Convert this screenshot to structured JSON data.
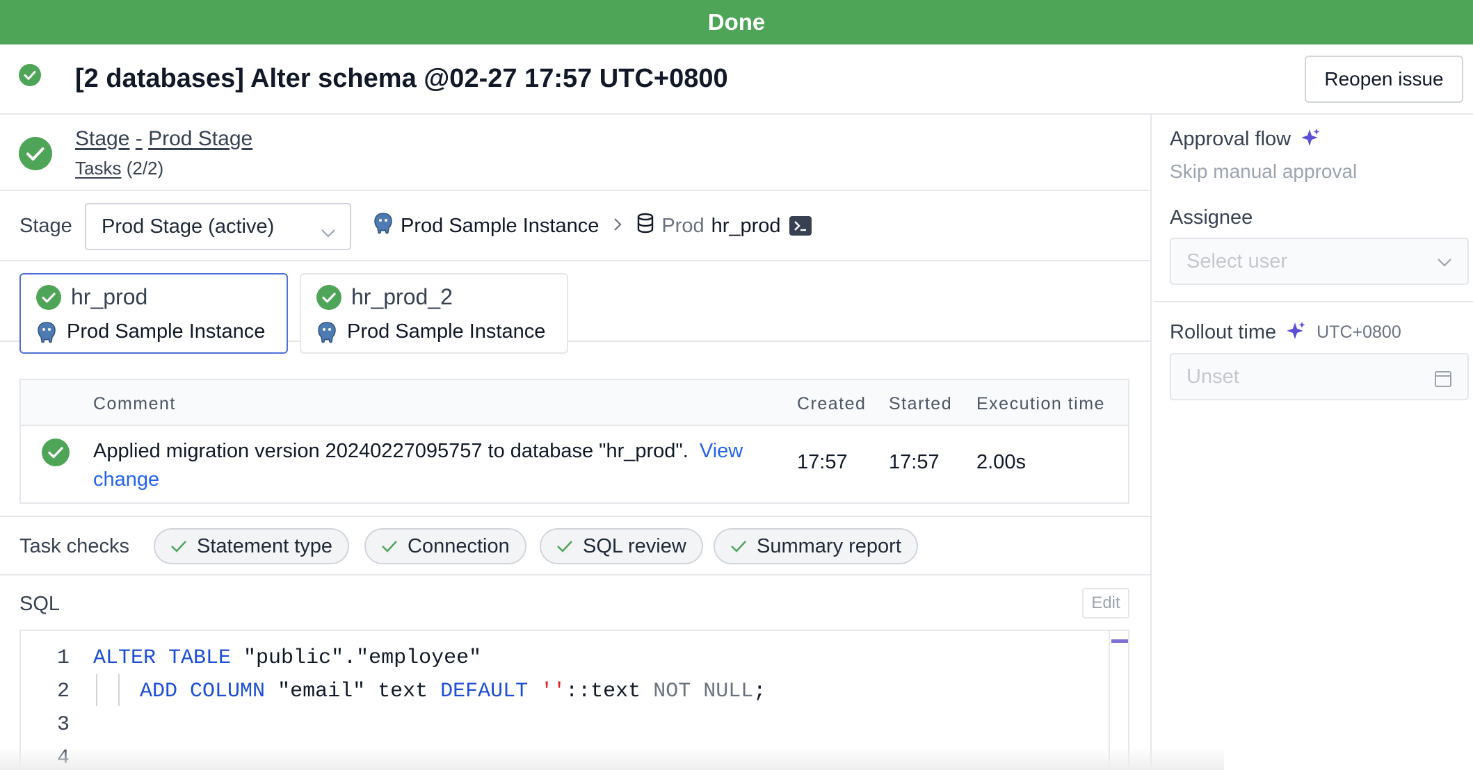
{
  "banner": {
    "status": "Done"
  },
  "header": {
    "title": "[2 databases] Alter schema @02-27 17:57 UTC+0800",
    "reopen_label": "Reopen issue"
  },
  "stage_header": {
    "stage_word": "Stage",
    "separator": "-",
    "stage_name": "Prod Stage",
    "tasks_word": "Tasks",
    "tasks_count": "(2/2)"
  },
  "stage_selector": {
    "label": "Stage",
    "selected": "Prod Stage (active)",
    "instance": "Prod Sample Instance",
    "env": "Prod",
    "database": "hr_prod"
  },
  "database_cards": [
    {
      "name": "hr_prod",
      "instance": "Prod Sample Instance",
      "active": true
    },
    {
      "name": "hr_prod_2",
      "instance": "Prod Sample Instance",
      "active": false
    }
  ],
  "runs_table": {
    "headers": {
      "comment": "Comment",
      "created": "Created",
      "started": "Started",
      "execution": "Execution time"
    },
    "rows": [
      {
        "comment": "Applied migration version 20240227095757 to database \"hr_prod\".",
        "link": "View change",
        "created": "17:57",
        "started": "17:57",
        "execution": "2.00s"
      }
    ]
  },
  "task_checks": {
    "label": "Task checks",
    "items": [
      "Statement type",
      "Connection",
      "SQL review",
      "Summary report"
    ]
  },
  "sql": {
    "label": "SQL",
    "edit_label": "Edit",
    "line_numbers": [
      "1",
      "2",
      "3",
      "4"
    ],
    "line1": {
      "k1": "ALTER",
      "k2": "TABLE",
      "rest": " \"public\".\"employee\""
    },
    "line2": {
      "k1": "ADD",
      "k2": "COLUMN",
      "col": " \"email\" text ",
      "k3": "DEFAULT",
      "str": "''",
      "cast": "::text ",
      "k4": "NOT NULL",
      "end": ";"
    }
  },
  "sidebar": {
    "approval_flow_label": "Approval flow",
    "approval_flow_value": "Skip manual approval",
    "assignee_label": "Assignee",
    "assignee_placeholder": "Select user",
    "rollout_label": "Rollout time",
    "rollout_tz": "UTC+0800",
    "rollout_placeholder": "Unset"
  },
  "colors": {
    "success": "#4ea457",
    "link": "#2563eb",
    "accent": "#5b4fd6"
  }
}
